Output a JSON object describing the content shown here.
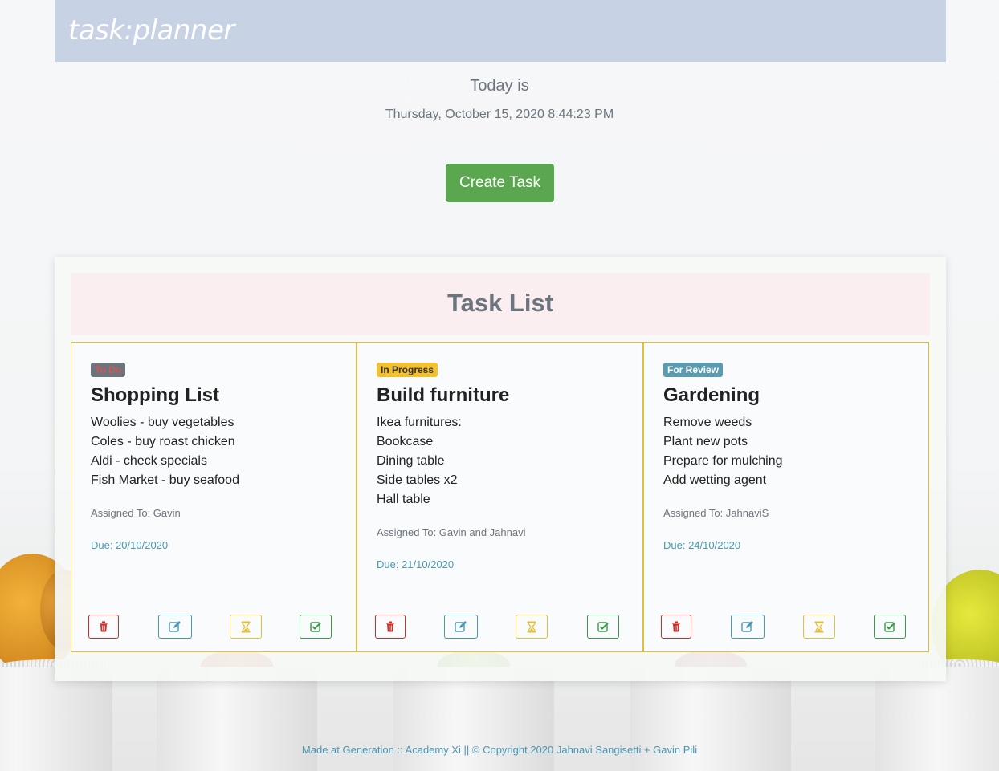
{
  "header": {
    "brand": "task:planner"
  },
  "today": {
    "label": "Today is",
    "datetime": "Thursday, October 15, 2020 8:44:23 PM"
  },
  "create_button": {
    "label": "Create Task"
  },
  "task_list": {
    "title": "Task List",
    "tasks": [
      {
        "status": "To Do",
        "title": "Shopping List",
        "items": [
          "Woolies - buy vegetables",
          "Coles - buy roast chicken",
          "Aldi - check specials",
          "Fish Market - buy seafood"
        ],
        "assigned": "Assigned To: Gavin",
        "due": "Due: 20/10/2020"
      },
      {
        "status": "In Progress",
        "title": "Build furniture",
        "items": [
          "Ikea furnitures:",
          "Bookcase",
          "Dining table",
          "Side tables x2",
          "Hall table"
        ],
        "assigned": "Assigned To: Gavin and Jahnavi",
        "due": "Due: 21/10/2020"
      },
      {
        "status": "For Review",
        "title": "Gardening",
        "items": [
          "Remove weeds",
          "Plant new pots",
          "Prepare for mulching",
          "Add wetting agent"
        ],
        "assigned": "Assigned To: JahnaviS",
        "due": "Due: 24/10/2020"
      }
    ]
  },
  "icons": {
    "delete": "trash-icon",
    "edit": "edit-icon",
    "in_progress": "hourglass-icon",
    "done": "check-square-icon"
  },
  "colors": {
    "header_bg": "#c8d2e5",
    "create_button": "#5ba74f",
    "card_border": "#e2bf3a",
    "delete": "#c9302c",
    "edit": "#4a98b4",
    "progress": "#e2bf3a",
    "done": "#3c9a4b"
  },
  "footer": {
    "text": "Made at Generation :: Academy Xi || © Copyright 2020 Jahnavi Sangisetti + Gavin Pili"
  }
}
